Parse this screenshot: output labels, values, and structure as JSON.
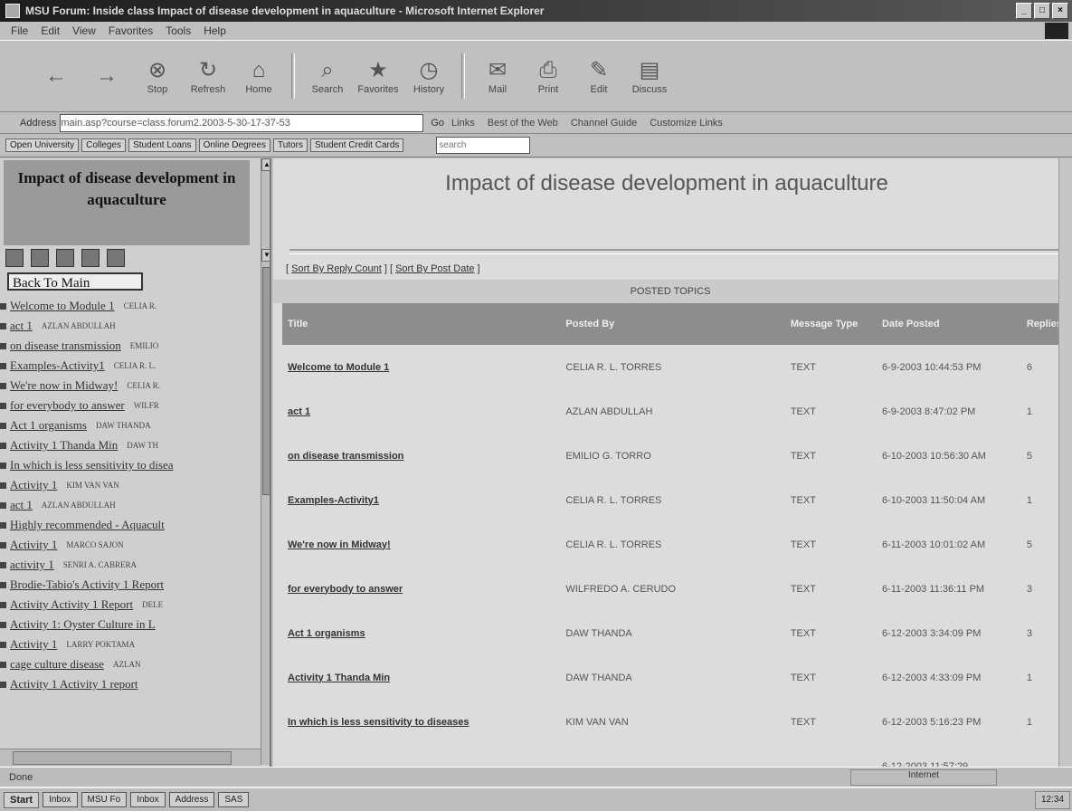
{
  "window": {
    "title": "MSU Forum: Inside class Impact of disease development in aquaculture - Microsoft Internet Explorer"
  },
  "menu": [
    "File",
    "Edit",
    "View",
    "Favorites",
    "Tools",
    "Help"
  ],
  "toolbar": [
    {
      "label": "",
      "icon": "back-arrow-icon"
    },
    {
      "label": "",
      "icon": "forward-arrow-icon"
    },
    {
      "label": "Stop",
      "icon": "stop-icon"
    },
    {
      "label": "Refresh",
      "icon": "refresh-icon"
    },
    {
      "label": "Home",
      "icon": "home-icon"
    },
    {
      "label": "Search",
      "icon": "search-icon"
    },
    {
      "label": "Favorites",
      "icon": "favorites-icon"
    },
    {
      "label": "History",
      "icon": "history-icon"
    },
    {
      "label": "Mail",
      "icon": "mail-icon"
    },
    {
      "label": "Print",
      "icon": "print-icon"
    },
    {
      "label": "Edit",
      "icon": "edit-icon"
    },
    {
      "label": "Discuss",
      "icon": "discuss-icon"
    }
  ],
  "address": {
    "label": "Address",
    "url": "main.asp?course=class.forum2.2003-5-30-17-37-53",
    "go": "Go",
    "links": [
      "Links",
      "Best of the Web",
      "Channel Guide",
      "Customize Links"
    ]
  },
  "links_bar": [
    "Open University",
    "Colleges",
    "Student Loans",
    "Online Degrees",
    "Tutors",
    "Student Credit Cards"
  ],
  "links_bar_search": "search",
  "forum": {
    "header": "Impact of disease development in aquaculture",
    "back_label": "Back To Main",
    "sort_reply": "Sort By Reply Count",
    "sort_post": "Sort By Post Date",
    "posted_topics": "POSTED TOPICS",
    "columns": [
      "Title",
      "Posted By",
      "Message Type",
      "Date Posted",
      "Replies"
    ],
    "rows": [
      {
        "title": "Welcome to Module 1",
        "by": "CELIA R. L. TORRES",
        "type": "TEXT",
        "date": "6-9-2003 10:44:53 PM",
        "replies": "6"
      },
      {
        "title": "act 1",
        "by": "AZLAN ABDULLAH",
        "type": "TEXT",
        "date": "6-9-2003 8:47:02 PM",
        "replies": "1"
      },
      {
        "title": "on disease transmission",
        "by": "EMILIO G. TORRO",
        "type": "TEXT",
        "date": "6-10-2003 10:56:30 AM",
        "replies": "5"
      },
      {
        "title": "Examples-Activity1",
        "by": "CELIA R. L. TORRES",
        "type": "TEXT",
        "date": "6-10-2003 11:50:04 AM",
        "replies": "1"
      },
      {
        "title": "We're now in Midway!",
        "by": "CELIA R. L. TORRES",
        "type": "TEXT",
        "date": "6-11-2003 10:01:02 AM",
        "replies": "5"
      },
      {
        "title": "for everybody to answer",
        "by": "WILFREDO A. CERUDO",
        "type": "TEXT",
        "date": "6-11-2003 11:36:11 PM",
        "replies": "3"
      },
      {
        "title": "Act 1 organisms",
        "by": "DAW THANDA",
        "type": "TEXT",
        "date": "6-12-2003 3:34:09 PM",
        "replies": "3"
      },
      {
        "title": "Activity 1 Thanda Min",
        "by": "DAW THANDA",
        "type": "TEXT",
        "date": "6-12-2003 4:33:09 PM",
        "replies": "1"
      },
      {
        "title": "In which is less sensitivity to diseases",
        "by": "KIM VAN VAN",
        "type": "TEXT",
        "date": "6-12-2003 5:16:23 PM",
        "replies": "1"
      },
      {
        "title": "",
        "by": "",
        "type": "",
        "date": "6-12-2003 11:57:29",
        "replies": ""
      }
    ]
  },
  "sidebar_topics": [
    {
      "title": "Welcome to Module 1",
      "author": "CELIA R."
    },
    {
      "title": "act 1",
      "author": "AZLAN ABDULLAH"
    },
    {
      "title": "on disease transmission",
      "author": "EMILIO"
    },
    {
      "title": "Examples-Activity1",
      "author": "CELIA R. L."
    },
    {
      "title": "We're now in Midway!",
      "author": "CELIA R."
    },
    {
      "title": "for everybody to answer",
      "author": "WILFR"
    },
    {
      "title": "Act 1 organisms",
      "author": "DAW THANDA"
    },
    {
      "title": "Activity 1 Thanda Min",
      "author": "DAW TH"
    },
    {
      "title": "In which is less sensitivity to disea",
      "author": ""
    },
    {
      "title": "Activity 1",
      "author": "KIM VAN VAN"
    },
    {
      "title": "act 1",
      "author": "AZLAN ABDULLAH"
    },
    {
      "title": "Highly recommended - Aquacult",
      "author": ""
    },
    {
      "title": "Activity 1",
      "author": "MARCO SAJON"
    },
    {
      "title": "activity 1",
      "author": "SENRI A. CABRERA"
    },
    {
      "title": "Brodie-Tabio's Activity 1 Report",
      "author": ""
    },
    {
      "title": "Activity Activity 1 Report",
      "author": "DELE"
    },
    {
      "title": "Activity 1: Oyster Culture in L",
      "author": ""
    },
    {
      "title": "Activity 1",
      "author": "LARRY POKTAMA"
    },
    {
      "title": "cage culture disease",
      "author": "AZLAN"
    },
    {
      "title": "Activity 1 Activity 1 report",
      "author": ""
    }
  ],
  "status": {
    "text": "Done",
    "zone": "Internet"
  },
  "taskbar": {
    "start": "Start",
    "items": [
      "Inbox",
      "MSU Fo",
      "Inbox",
      "Address",
      "SAS"
    ],
    "tray": "12:34"
  }
}
